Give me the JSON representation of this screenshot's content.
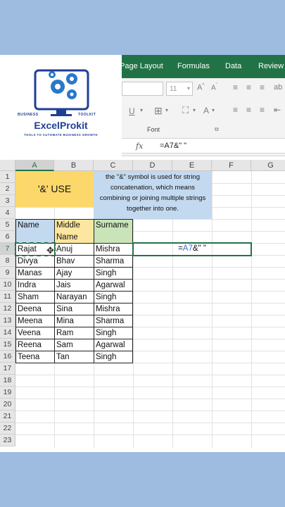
{
  "ribbon": {
    "tabs": [
      "Page Layout",
      "Formulas",
      "Data",
      "Review"
    ],
    "font_size": "11",
    "font_group_label": "Font"
  },
  "logo": {
    "name": "ExcelProkit",
    "left_word": "BUSINESS",
    "right_word": "TOOLKIT",
    "tagline": "TOOLS TO AUTOMATE BUSINESS GROWTH"
  },
  "formula_bar": {
    "fx": "fx",
    "text": "=A7&\" \""
  },
  "columns": [
    "A",
    "B",
    "C",
    "D",
    "E",
    "F",
    "G"
  ],
  "rows": [
    "1",
    "2",
    "3",
    "4",
    "5",
    "6",
    "7",
    "8",
    "9",
    "10",
    "11",
    "12",
    "13",
    "14",
    "15",
    "16",
    "17",
    "18",
    "19",
    "20",
    "21",
    "22",
    "23"
  ],
  "sheet": {
    "title": "'&' USE",
    "note": "the \"&\" symbol is used for string concatenation, which means combining or joining multiple strings together into one.",
    "headers": {
      "name": "Name",
      "middle_1": "Middle",
      "middle_2": "Name",
      "surname": "Surname"
    },
    "data": [
      [
        "Rajat",
        "Anuj",
        "Mishra"
      ],
      [
        "Divya",
        "Bhav",
        "Sharma"
      ],
      [
        "Manas",
        "Ajay",
        "Singh"
      ],
      [
        "Indra",
        "Jais",
        "Agarwal"
      ],
      [
        "Sham",
        "Narayan",
        "Singh"
      ],
      [
        "Deena",
        "Sina",
        "Mishra"
      ],
      [
        "Meena",
        "Mina",
        "Sharma"
      ],
      [
        "Veena",
        "Ram",
        "Singh"
      ],
      [
        "Reena",
        "Sam",
        "Agarwal"
      ],
      [
        "Teena",
        "Tan",
        "Singh"
      ]
    ],
    "formula_eq": "=",
    "formula_ref": "A7",
    "formula_rest": "&\" \""
  },
  "colors": {
    "excel_green": "#217346",
    "title_fill": "#fcd86b",
    "note_fill": "#c3d9ef",
    "name_fill": "#c3d9ef",
    "middle_fill": "#fde7a0",
    "surname_fill": "#c9e4b8"
  }
}
